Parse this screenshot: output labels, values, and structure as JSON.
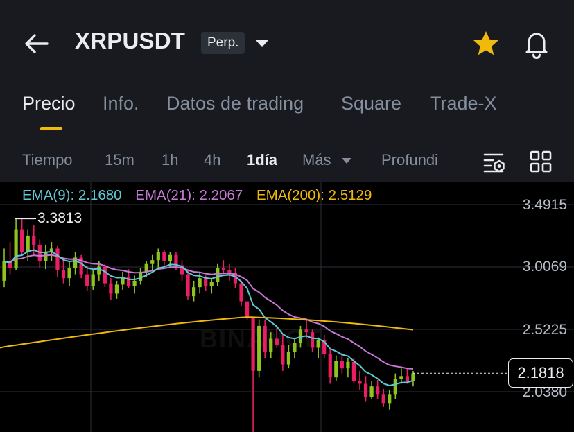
{
  "header": {
    "symbol": "XRPUSDT",
    "contract_type": "Perp.",
    "accent_color": "#f0b90b"
  },
  "tabs": [
    {
      "label": "Precio",
      "active": true
    },
    {
      "label": "Info.",
      "active": false
    },
    {
      "label": "Datos de trading",
      "active": false
    },
    {
      "label": "Square",
      "active": false
    },
    {
      "label": "Trade-X",
      "active": false
    }
  ],
  "intervals": [
    {
      "label": "Tiempo",
      "active": false
    },
    {
      "label": "15m",
      "active": false
    },
    {
      "label": "1h",
      "active": false
    },
    {
      "label": "4h",
      "active": false
    },
    {
      "label": "1día",
      "active": true
    },
    {
      "label": "Más",
      "active": false
    },
    {
      "label": "Profundi",
      "active": false
    }
  ],
  "indicators": {
    "ema9": {
      "label": "EMA(9): 2.1680",
      "color": "#5fc9d6"
    },
    "ema21": {
      "label": "EMA(21): 2.2067",
      "color": "#c679d4"
    },
    "ema200": {
      "label": "EMA(200): 2.5129",
      "color": "#f0b90b"
    }
  },
  "y_axis_labels": [
    "3.4915",
    "3.0069",
    "2.5225",
    "2.0380"
  ],
  "current_price": "2.1818",
  "high_marker": "3.3813",
  "watermark": "BINANCE",
  "colors": {
    "up": "#8fc31f",
    "down": "#e91e63",
    "background": "#000000"
  },
  "chart_data": {
    "type": "candlestick",
    "interval": "1día",
    "ylim": [
      2.038,
      3.4915
    ],
    "y_ticks": [
      3.4915,
      3.0069,
      2.5225,
      2.038
    ],
    "last_price": 2.1818,
    "high": 3.3813,
    "candles": [
      [
        2.9,
        3.15,
        2.85,
        3.05
      ],
      [
        3.05,
        3.2,
        2.95,
        3.0
      ],
      [
        3.0,
        3.38,
        2.98,
        3.3
      ],
      [
        3.3,
        3.381,
        3.1,
        3.12
      ],
      [
        3.12,
        3.3,
        3.05,
        3.25
      ],
      [
        3.25,
        3.33,
        3.1,
        3.18
      ],
      [
        3.18,
        3.22,
        3.0,
        3.05
      ],
      [
        3.05,
        3.18,
        2.99,
        3.12
      ],
      [
        3.12,
        3.2,
        3.05,
        3.15
      ],
      [
        3.15,
        3.17,
        2.93,
        2.98
      ],
      [
        2.98,
        3.08,
        2.88,
        2.92
      ],
      [
        2.92,
        3.05,
        2.86,
        3.0
      ],
      [
        3.0,
        3.12,
        2.95,
        3.08
      ],
      [
        3.08,
        3.1,
        2.92,
        2.95
      ],
      [
        2.95,
        3.02,
        2.82,
        2.86
      ],
      [
        2.86,
        2.98,
        2.83,
        2.95
      ],
      [
        2.95,
        3.05,
        2.9,
        3.01
      ],
      [
        3.01,
        3.03,
        2.85,
        2.88
      ],
      [
        2.88,
        2.92,
        2.75,
        2.8
      ],
      [
        2.8,
        2.9,
        2.76,
        2.87
      ],
      [
        2.87,
        2.97,
        2.83,
        2.93
      ],
      [
        2.93,
        2.99,
        2.84,
        2.86
      ],
      [
        2.86,
        2.94,
        2.8,
        2.9
      ],
      [
        2.9,
        3.0,
        2.87,
        2.97
      ],
      [
        2.97,
        3.05,
        2.93,
        3.03
      ],
      [
        3.03,
        3.1,
        2.98,
        3.06
      ],
      [
        3.06,
        3.15,
        3.0,
        3.12
      ],
      [
        3.12,
        3.14,
        3.02,
        3.05
      ],
      [
        3.05,
        3.12,
        3.0,
        3.1
      ],
      [
        3.1,
        3.12,
        2.98,
        3.02
      ],
      [
        3.02,
        3.06,
        2.9,
        2.95
      ],
      [
        2.95,
        2.99,
        2.75,
        2.78
      ],
      [
        2.78,
        2.9,
        2.74,
        2.85
      ],
      [
        2.85,
        2.96,
        2.8,
        2.92
      ],
      [
        2.92,
        2.94,
        2.82,
        2.86
      ],
      [
        2.86,
        2.91,
        2.8,
        2.89
      ],
      [
        2.89,
        3.03,
        2.86,
        3.0
      ],
      [
        3.0,
        3.06,
        2.95,
        2.98
      ],
      [
        2.98,
        3.03,
        2.9,
        2.96
      ],
      [
        2.96,
        3.0,
        2.84,
        2.88
      ],
      [
        2.88,
        2.9,
        2.7,
        2.74
      ],
      [
        2.74,
        2.73,
        2.6,
        2.62
      ],
      [
        2.62,
        2.62,
        1.6,
        2.2
      ],
      [
        2.2,
        2.6,
        2.15,
        2.55
      ],
      [
        2.55,
        2.6,
        2.3,
        2.35
      ],
      [
        2.35,
        2.5,
        2.3,
        2.45
      ],
      [
        2.45,
        2.55,
        2.38,
        2.4
      ],
      [
        2.4,
        2.48,
        2.2,
        2.25
      ],
      [
        2.25,
        2.4,
        2.22,
        2.35
      ],
      [
        2.35,
        2.45,
        2.3,
        2.42
      ],
      [
        2.42,
        2.55,
        2.38,
        2.52
      ],
      [
        2.52,
        2.6,
        2.45,
        2.5
      ],
      [
        2.5,
        2.52,
        2.35,
        2.38
      ],
      [
        2.38,
        2.46,
        2.3,
        2.44
      ],
      [
        2.44,
        2.48,
        2.3,
        2.33
      ],
      [
        2.33,
        2.38,
        2.1,
        2.15
      ],
      [
        2.15,
        2.32,
        2.12,
        2.28
      ],
      [
        2.28,
        2.34,
        2.18,
        2.22
      ],
      [
        2.22,
        2.3,
        2.15,
        2.27
      ],
      [
        2.27,
        2.3,
        2.1,
        2.12
      ],
      [
        2.12,
        2.2,
        2.05,
        2.1
      ],
      [
        2.1,
        2.16,
        1.96,
        2.0
      ],
      [
        2.0,
        2.12,
        1.98,
        2.08
      ],
      [
        2.08,
        2.13,
        1.98,
        2.02
      ],
      [
        2.02,
        2.06,
        1.92,
        1.95
      ],
      [
        1.95,
        2.05,
        1.9,
        2.02
      ],
      [
        2.02,
        2.18,
        1.98,
        2.14
      ],
      [
        2.14,
        2.22,
        2.1,
        2.16
      ],
      [
        2.16,
        2.22,
        2.1,
        2.12
      ],
      [
        2.12,
        2.2,
        2.08,
        2.18
      ]
    ]
  }
}
